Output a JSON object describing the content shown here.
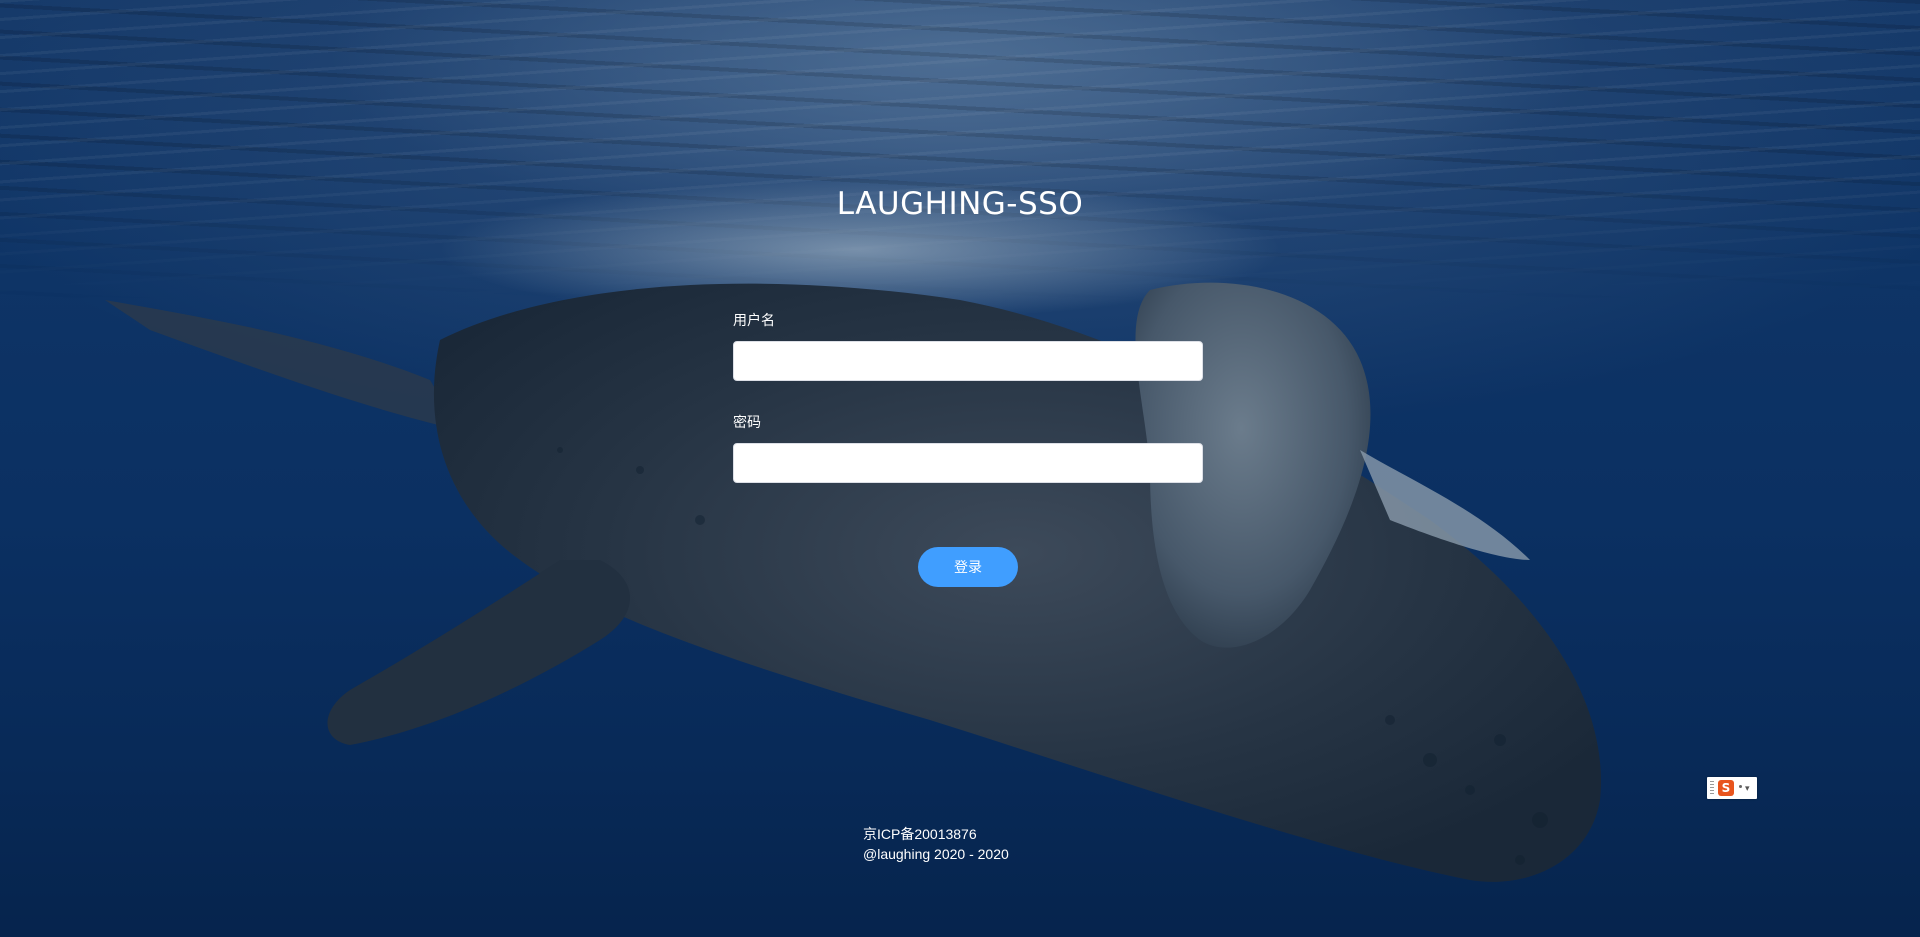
{
  "app": {
    "title": "LAUGHING-SSO"
  },
  "form": {
    "username_label": "用户名",
    "username_value": "",
    "password_label": "密码",
    "password_value": "",
    "login_label": "登录"
  },
  "footer": {
    "icp": "京ICP备20013876",
    "copyright": "@laughing 2020 - 2020"
  },
  "ime": {
    "logo_text": "S",
    "logo_color": "#e8541d",
    "icon": "sogou-ime-icon"
  },
  "colors": {
    "accent": "#409eff",
    "background": "#0b3062"
  }
}
